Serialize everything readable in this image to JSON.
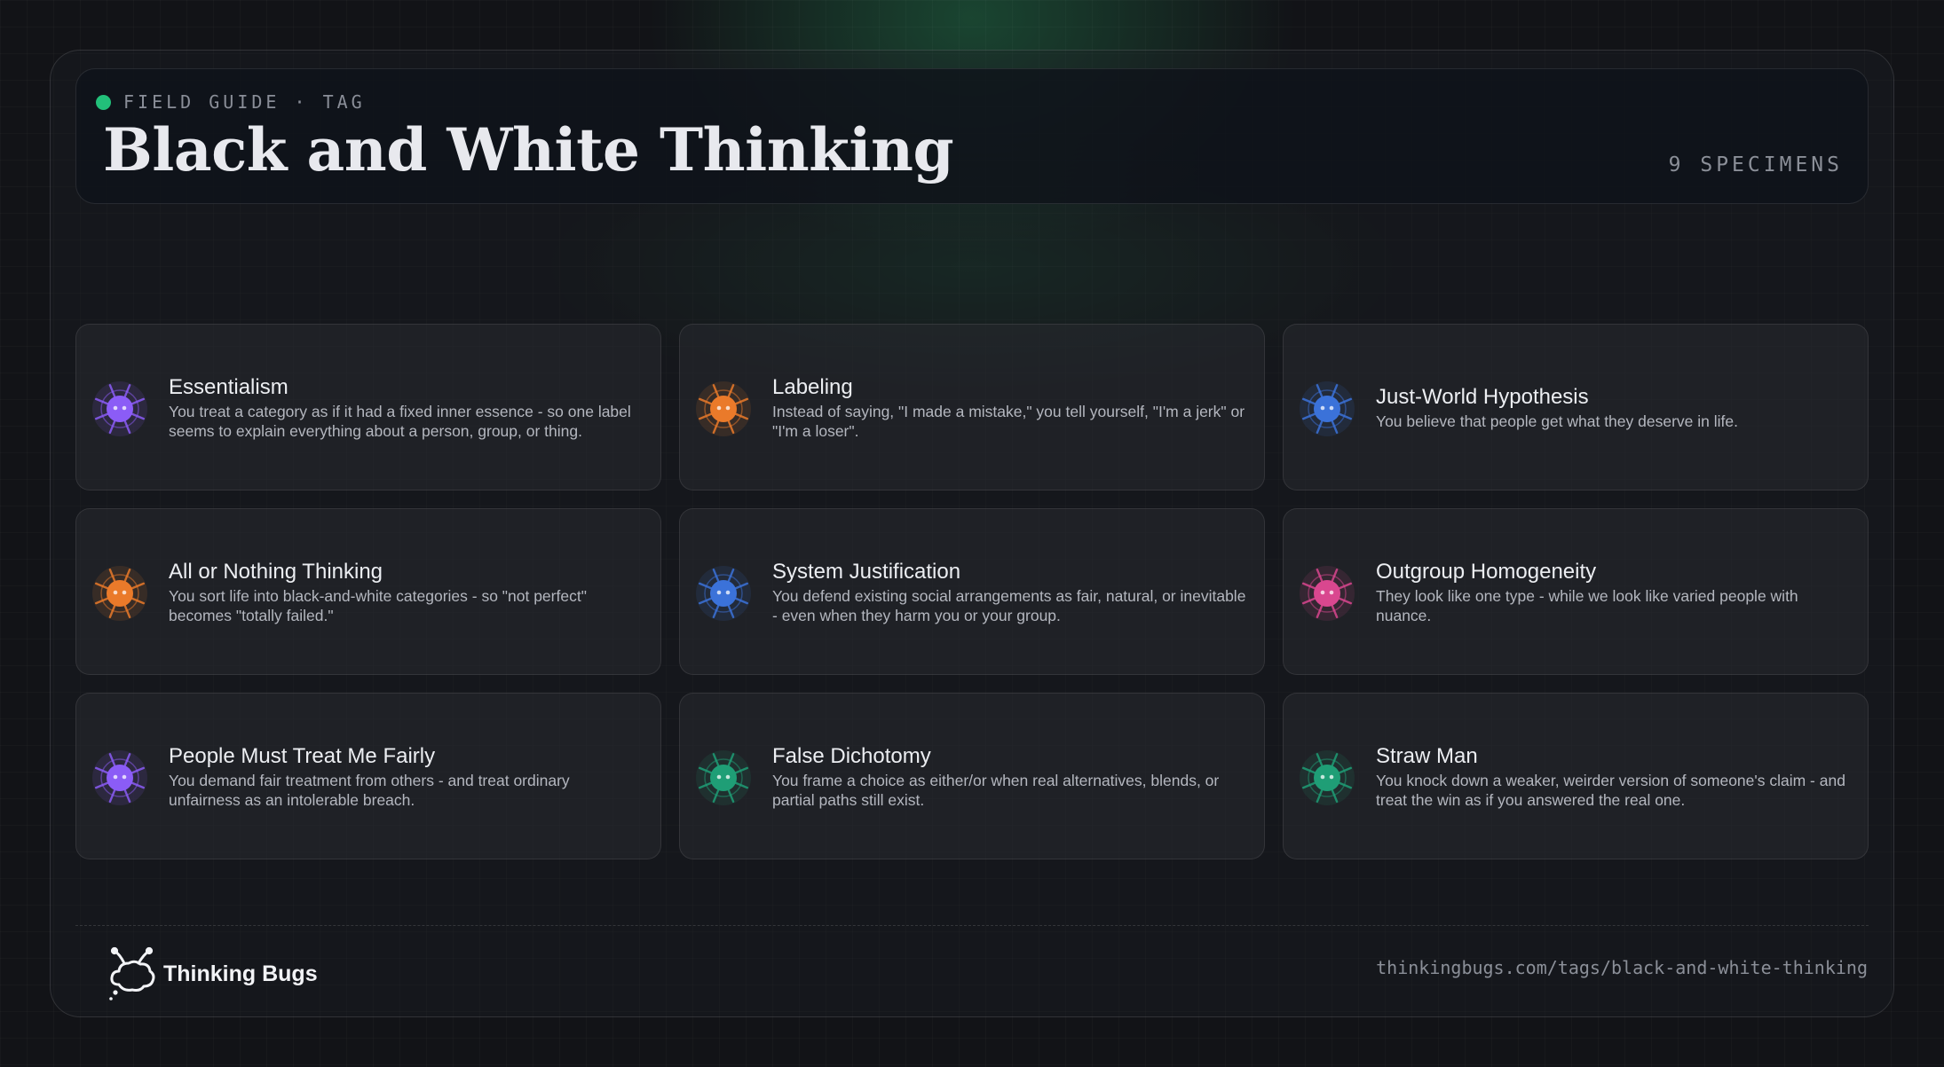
{
  "header": {
    "eyebrow": "FIELD GUIDE · TAG",
    "title": "Black and White Thinking",
    "count": "9 SPECIMENS",
    "status_color": "#22c07a"
  },
  "cards": [
    {
      "title": "Essentialism",
      "description": "You treat a category as if it had a fixed inner essence - so one label seems to explain everything about a person, group, or thing.",
      "icon": "purple-bug-icon",
      "color": "#8b5cf6"
    },
    {
      "title": "Labeling",
      "description": "Instead of saying, \"I made a mistake,\" you tell yourself, \"I'm a jerk\" or \"I'm a loser\".",
      "icon": "orange-bug-icon",
      "color": "#ea7a2a"
    },
    {
      "title": "Just-World Hypothesis",
      "description": "You believe that people get what they deserve in life.",
      "icon": "blue-bug-icon",
      "color": "#3b72d9"
    },
    {
      "title": "All or Nothing Thinking",
      "description": "You sort life into black-and-white categories - so \"not perfect\" becomes \"totally failed.\"",
      "icon": "orange-bug-icon",
      "color": "#ea7a2a"
    },
    {
      "title": "System Justification",
      "description": "You defend existing social arrangements as fair, natural, or inevitable - even when they harm you or your group.",
      "icon": "blue-bug-icon",
      "color": "#3b72d9"
    },
    {
      "title": "Outgroup Homogeneity",
      "description": "They look like one type - while we look like varied people with nuance.",
      "icon": "pink-bug-icon",
      "color": "#d9478f"
    },
    {
      "title": "People Must Treat Me Fairly",
      "description": "You demand fair treatment from others - and treat ordinary unfairness as an intolerable breach.",
      "icon": "purple-bug-icon",
      "color": "#8b5cf6"
    },
    {
      "title": "False Dichotomy",
      "description": "You frame a choice as either/or when real alternatives, blends, or partial paths still exist.",
      "icon": "green-bug-icon",
      "color": "#1f9e76"
    },
    {
      "title": "Straw Man",
      "description": "You knock down a weaker, weirder version of someone's claim - and treat the win as if you answered the real one.",
      "icon": "green-bug-icon",
      "color": "#1f9e76"
    }
  ],
  "footer": {
    "brand": "Thinking Bugs",
    "brand_icon": "thinking-bug-logo-icon",
    "url": "thinkingbugs.com/tags/black-and-white-thinking"
  }
}
